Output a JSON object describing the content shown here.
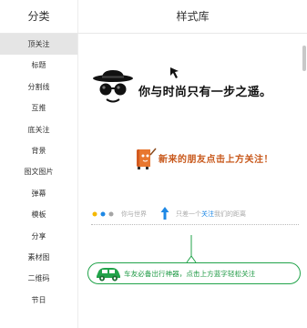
{
  "header": {
    "left_title": "分类",
    "main_title": "样式库"
  },
  "sidebar": {
    "active_index": 0,
    "items": [
      {
        "label": "顶关注"
      },
      {
        "label": "标题"
      },
      {
        "label": "分割线"
      },
      {
        "label": "互推"
      },
      {
        "label": "底关注"
      },
      {
        "label": "背景"
      },
      {
        "label": "图文图片"
      },
      {
        "label": "弹幕"
      },
      {
        "label": "模板"
      },
      {
        "label": "分享"
      },
      {
        "label": "素材图"
      },
      {
        "label": "二维码"
      },
      {
        "label": "节日"
      }
    ]
  },
  "styles": {
    "s1_text": "你与时尚只有一步之遥。",
    "s2_text": "新来的朋友点击上方关注！",
    "s3_left": "你与世界",
    "s3_right_a": "只差一个",
    "s3_right_highlight": "关注",
    "s3_right_b": "我们的距离",
    "s4_text": "车友必备出行神器，点击上方蓝字轻松关注"
  },
  "colors": {
    "active_bg": "#e5e5e5",
    "orange_text": "#c8581b",
    "link_blue": "#1e88e5",
    "green": "#21a34a"
  },
  "icons": {
    "s1": "sunglasses-hat-face-icon",
    "s1_cursor": "cursor-arrow-icon",
    "s2": "book-mascot-icon",
    "s3": "up-arrow-icon",
    "s4": "car-icon"
  }
}
